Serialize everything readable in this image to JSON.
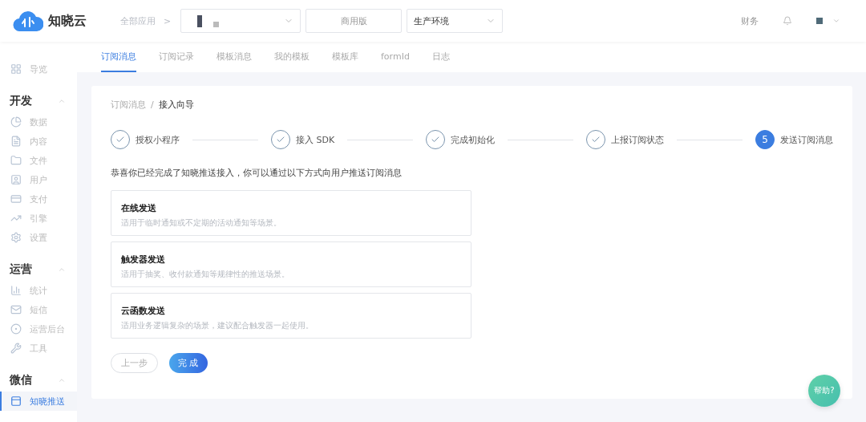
{
  "header": {
    "logo_text": "知晓云",
    "breadcrumb": "全部应用",
    "breadcrumb_separator": ">",
    "edition": "商用版",
    "environment": "生产环境",
    "finance": "财务"
  },
  "sidebar": {
    "top_item": {
      "label": "导览",
      "selected": false
    },
    "groups": [
      {
        "title": "开发",
        "expanded": true,
        "items": [
          {
            "label": "数据",
            "selected": false
          },
          {
            "label": "内容",
            "selected": false
          },
          {
            "label": "文件",
            "selected": false
          },
          {
            "label": "用户",
            "selected": false
          },
          {
            "label": "支付",
            "selected": false
          },
          {
            "label": "引擎",
            "selected": false
          },
          {
            "label": "设置",
            "selected": false
          }
        ]
      },
      {
        "title": "运营",
        "expanded": true,
        "items": [
          {
            "label": "统计",
            "selected": false
          },
          {
            "label": "短信",
            "selected": false
          },
          {
            "label": "运营后台",
            "selected": false
          },
          {
            "label": "工具",
            "selected": false
          }
        ]
      },
      {
        "title": "微信",
        "expanded": true,
        "items": [
          {
            "label": "知晓推送",
            "selected": true
          }
        ]
      }
    ]
  },
  "tabs": [
    {
      "label": "订阅消息",
      "selected": true
    },
    {
      "label": "订阅记录",
      "selected": false
    },
    {
      "label": "模板消息",
      "selected": false
    },
    {
      "label": "我的模板",
      "selected": false
    },
    {
      "label": "模板库",
      "selected": false
    },
    {
      "label": "formId",
      "selected": false
    },
    {
      "label": "日志",
      "selected": false
    }
  ],
  "breadcrumb": [
    {
      "label": "订阅消息"
    },
    {
      "label": "接入向导"
    }
  ],
  "breadcrumb_separator": "/",
  "steps": [
    {
      "label": "授权小程序",
      "done": true
    },
    {
      "label": "接入 SDK",
      "done": true
    },
    {
      "label": "完成初始化",
      "done": true
    },
    {
      "label": "上报订阅状态",
      "done": true
    },
    {
      "label": "发送订阅消息",
      "done": false,
      "number": "5"
    }
  ],
  "intro": "恭喜你已经完成了知晓推送接入，你可以通过以下方式向用户推送订阅消息",
  "options": [
    {
      "title": "在线发送",
      "description": "适用于临时通知或不定期的活动通知等场景。"
    },
    {
      "title": "触发器发送",
      "description": "适用于抽奖、收付款通知等规律性的推送场景。"
    },
    {
      "title": "云函数发送",
      "description": "适用业务逻辑复杂的场景，建议配合触发器一起使用。"
    }
  ],
  "buttons": {
    "back": "上一步",
    "finish": "完 成"
  },
  "help": "帮助?"
}
